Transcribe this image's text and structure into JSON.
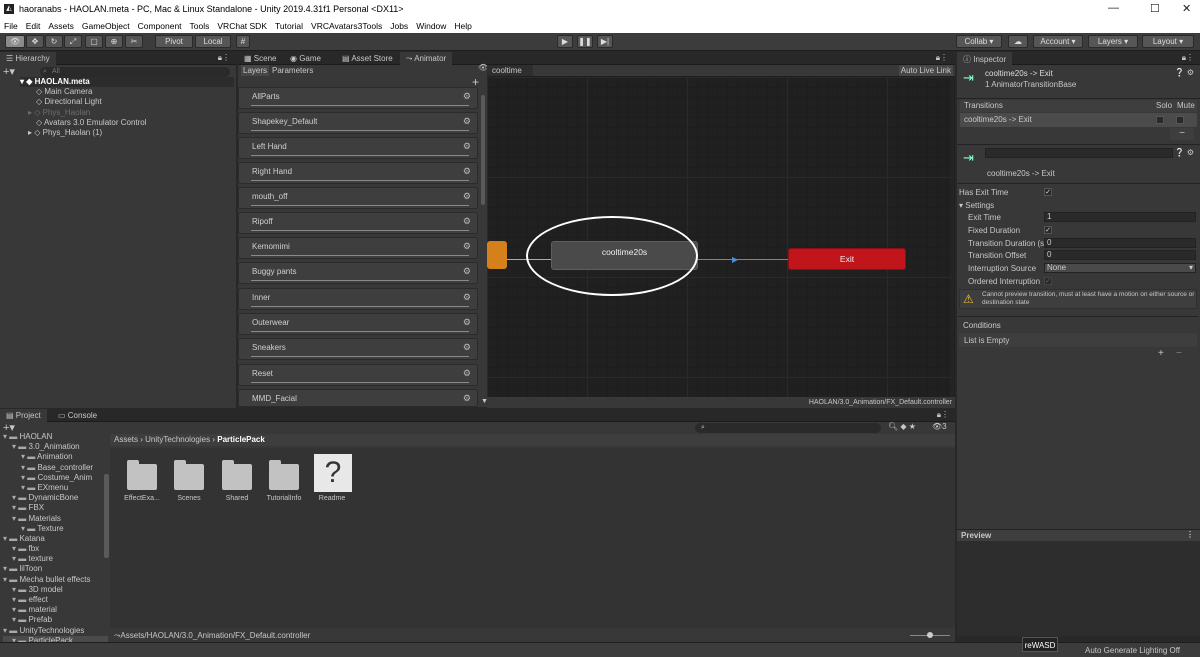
{
  "window": {
    "title": "haoranabs - HAOLAN.meta - PC, Mac & Linux Standalone - Unity 2019.4.31f1 Personal <DX11>",
    "min": "—",
    "max": "☐",
    "close": "✕"
  },
  "menu": [
    "File",
    "Edit",
    "Assets",
    "GameObject",
    "Component",
    "Tools",
    "VRChat SDK",
    "Tutorial",
    "VRCAvatars3Tools",
    "Jobs",
    "Window",
    "Help"
  ],
  "toolbar": {
    "pivot": "Pivot",
    "local": "Local",
    "collab": "Collab ▾",
    "account": "Account ▾",
    "layers": "Layers ▾",
    "layout": "Layout ▾"
  },
  "hierarchy": {
    "tab": "Hierarchy",
    "search_placeholder": "All",
    "root": "HAOLAN.meta",
    "items": [
      "Main Camera",
      "Directional Light",
      "Phys_Haolan",
      "Avatars 3.0 Emulator Control",
      "Phys_Haolan (1)"
    ]
  },
  "center_tabs": [
    "Scene",
    "Game",
    "Asset Store",
    "Animator"
  ],
  "animator": {
    "tab_layers": "Layers",
    "tab_parameters": "Parameters",
    "breadcrumb": "cooltime",
    "auto_live_link": "Auto Live Link",
    "layers": [
      "AllParts",
      "Shapekey_Default",
      "Left Hand",
      "Right Hand",
      "mouth_off",
      "Ripoff",
      "Kemomimi",
      "Buggy pants",
      "Inner",
      "Outerwear",
      "Sneakers",
      "Reset",
      "MMD_Facial"
    ],
    "state_name": "cooltime20s",
    "exit_label": "Exit",
    "path": "HAOLAN/3.0_Animation/FX_Default.controller"
  },
  "inspector": {
    "tab": "Inspector",
    "header_title": "cooltime20s -> Exit",
    "header_sub": "1 AnimatorTransitionBase",
    "transitions_label": "Transitions",
    "solo": "Solo",
    "mute": "Mute",
    "transition_item": "cooltime20s -> Exit",
    "name_label": "cooltime20s -> Exit",
    "has_exit_time": "Has Exit Time",
    "settings": "Settings",
    "fields": [
      {
        "label": "Exit Time",
        "value": "1"
      },
      {
        "label": "Fixed Duration",
        "value": "✓"
      },
      {
        "label": "Transition Duration (s",
        "value": "0"
      },
      {
        "label": "Transition Offset",
        "value": "0"
      },
      {
        "label": "Interruption Source",
        "value": "None"
      },
      {
        "label": "Ordered Interruption",
        "value": "✓"
      }
    ],
    "warning": "Cannot preview transition, must at least have a motion on either source or destination state",
    "conditions": "Conditions",
    "list_empty": "List is Empty",
    "preview": "Preview"
  },
  "project": {
    "tab_project": "Project",
    "tab_console": "Console",
    "breadcrumb": [
      "Assets",
      "UnityTechnologies",
      "ParticlePack"
    ],
    "tree": [
      {
        "t": "HAOLAN",
        "d": 0
      },
      {
        "t": "3.0_Animation",
        "d": 1
      },
      {
        "t": "Animation",
        "d": 2
      },
      {
        "t": "Base_controller",
        "d": 2
      },
      {
        "t": "Costume_Anim",
        "d": 2
      },
      {
        "t": "EXmenu",
        "d": 2
      },
      {
        "t": "DynamicBone",
        "d": 1
      },
      {
        "t": "FBX",
        "d": 1
      },
      {
        "t": "Materials",
        "d": 1
      },
      {
        "t": "Texture",
        "d": 2
      },
      {
        "t": "Katana",
        "d": 0
      },
      {
        "t": "fbx",
        "d": 1
      },
      {
        "t": "texture",
        "d": 1
      },
      {
        "t": "lilToon",
        "d": 0
      },
      {
        "t": "Mecha bullet effects",
        "d": 0
      },
      {
        "t": "3D model",
        "d": 1
      },
      {
        "t": "effect",
        "d": 1
      },
      {
        "t": "material",
        "d": 1
      },
      {
        "t": "Prefab",
        "d": 1
      },
      {
        "t": "UnityTechnologies",
        "d": 0
      },
      {
        "t": "ParticlePack",
        "d": 1
      }
    ],
    "assets": [
      "EffectExa...",
      "Scenes",
      "Shared",
      "TutorialInfo",
      "Readme"
    ],
    "bottom_path": "Assets/HAOLAN/3.0_Animation/FX_Default.controller",
    "badge_count": "3"
  },
  "status": {
    "rewasd": "reWASD",
    "lighting": "Auto Generate Lighting Off"
  },
  "colors": {
    "exit_node": "#c0161b",
    "state_node": "#4a4a4a",
    "entry_node": "#d4811c",
    "transition": "#4a90d9",
    "annotation": "#ffffff"
  }
}
